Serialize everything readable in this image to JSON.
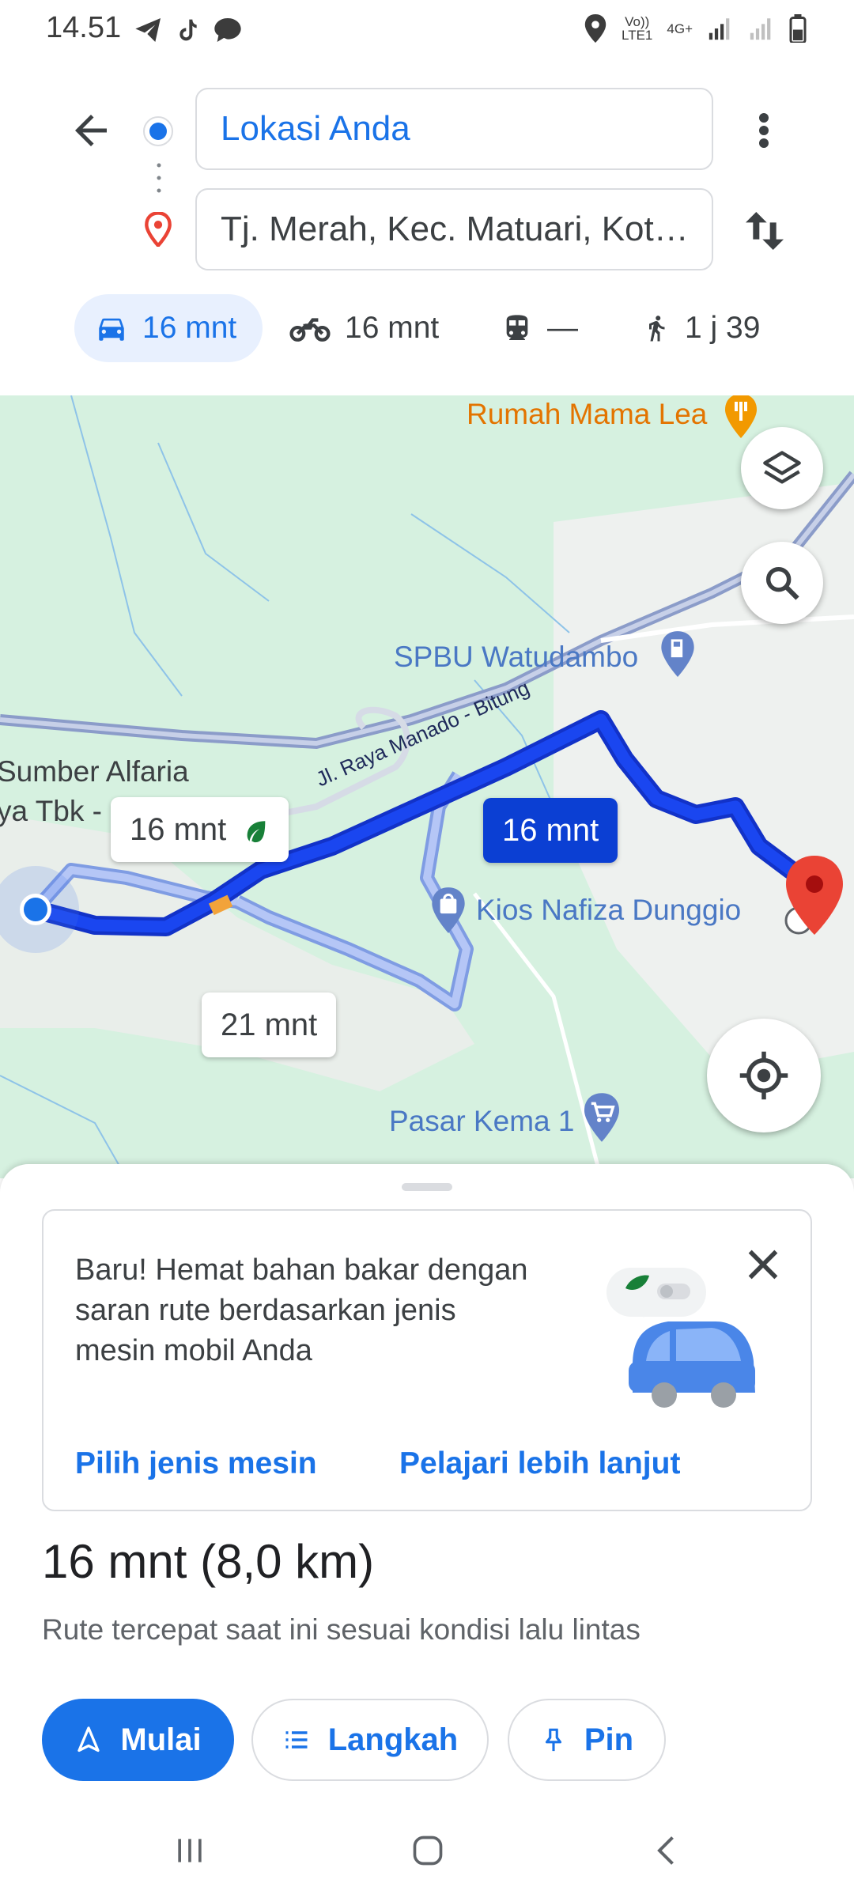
{
  "status_bar": {
    "time": "14.51",
    "network_line1": "Vo))",
    "network_line2": "LTE1",
    "network_type": "4G+",
    "left_icons": [
      "telegram-icon",
      "tiktok-icon",
      "message-icon"
    ],
    "right_icons": [
      "location-icon",
      "signal-icon",
      "signal-icon",
      "battery-icon"
    ]
  },
  "route": {
    "origin": "Lokasi Anda",
    "destination": "Tj. Merah, Kec. Matuari, Kot…"
  },
  "modes": [
    {
      "icon": "car-icon",
      "label": "16 mnt",
      "active": true
    },
    {
      "icon": "motorcycle-icon",
      "label": "16 mnt",
      "active": false
    },
    {
      "icon": "train-icon",
      "label": "—",
      "active": false
    },
    {
      "icon": "walk-icon",
      "label": "1 j 39",
      "active": false
    }
  ],
  "map": {
    "pois": {
      "restaurant": "Rumah Mama Lea",
      "gas_station": "SPBU Watudambo",
      "store": "Sumber Alfaria",
      "store_line2": "ya Tbk -",
      "kiosk": "Kios Nafiza Dunggio",
      "market": "Pasar Kema 1"
    },
    "road_label": "Jl. Raya Manado - Bitung",
    "route_callouts": {
      "selected": "16 mnt",
      "alternative_eco": "16 mnt",
      "alternative": "21 mnt"
    },
    "colors": {
      "route_selected": "#1a46f0",
      "route_alternative": "#a9bdf5",
      "destination_pin": "#ea4335"
    }
  },
  "promo": {
    "text": "Baru! Hemat bahan bakar dengan saran rute berdasarkan jenis mesin mobil Anda",
    "link_engine": "Pilih jenis mesin",
    "link_learn": "Pelajari lebih lanjut"
  },
  "summary": {
    "time_distance": "16 mnt (8,0 km)",
    "description": "Rute tercepat saat ini sesuai kondisi lalu lintas"
  },
  "actions": {
    "start": "Mulai",
    "steps": "Langkah",
    "pin": "Pin"
  }
}
